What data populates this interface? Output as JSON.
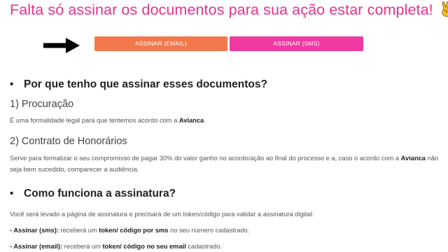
{
  "headline": {
    "text": "Falta só assinar os documentos para sua ação estar completa!",
    "emoji": "victory-hand-icon"
  },
  "buttons": {
    "email_label": "ASSINAR (EMAIL)",
    "sms_label": "ASSINAR (SMS)"
  },
  "colors": {
    "headline": "#e8318f",
    "email_button": "#f2784b",
    "sms_button": "#ef3aa1"
  },
  "section1": {
    "heading": "Por que tenho que assinar esses documentos?",
    "procuracao": {
      "title": "1) Procuração",
      "text_before": "É uma formalidade legal para que tentemos acordo com a ",
      "company": "Avianca",
      "text_after": "."
    },
    "contrato": {
      "title": "2) Contrato de Honorários",
      "text_before": "Serve para formalizar o seu compromisso de pagar 30% do valor ganho no acordo/ação ao final do processo e a, caso o acordo com a ",
      "company": "Avianca",
      "text_after": " não seja bem sucedido, comparecer a audiência."
    }
  },
  "section2": {
    "heading": "Como funciona a assinatura?",
    "intro": "Você será levado a página de assinatura e precisará de um token/código para validar a assinatura digital:",
    "sms": {
      "label": "- Assinar (sms):",
      "text1": " receberá um ",
      "bold": "token/ código por sms",
      "text2": " no seu número cadastrado."
    },
    "email": {
      "label": "- Assinar (email):",
      "text1": " receberá um ",
      "bold": "token/ código no seu email",
      "text2": " cadastrado."
    }
  }
}
